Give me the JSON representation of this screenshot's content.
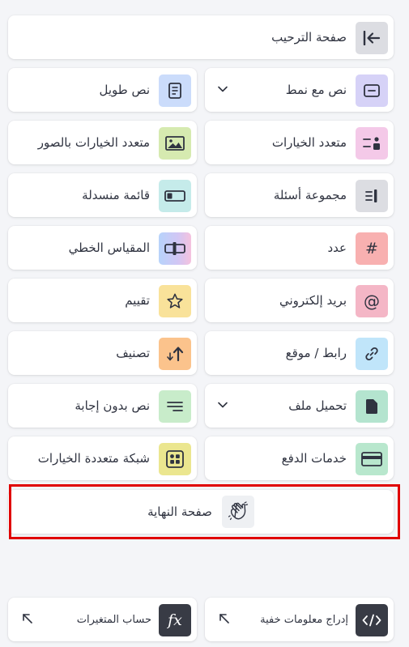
{
  "welcome": {
    "label": "صفحة الترحيب"
  },
  "items": {
    "styled_text": "نص مع نمط",
    "long_text": "نص طويل",
    "multiple_choice": "متعدد الخيارات",
    "picture_choice": "متعدد الخيارات بالصور",
    "question_group": "مجموعة أسئلة",
    "dropdown": "قائمة منسدلة",
    "number": "عدد",
    "opinion_scale": "المقياس الخطي",
    "email": "بريد إلكتروني",
    "rating": "تقييم",
    "website": "رابط / موقع",
    "ranking": "تصنيف",
    "file_upload": "تحميل ملف",
    "statement": "نص بدون إجابة",
    "payment": "خدمات الدفع",
    "matrix": "شبكة متعددة الخيارات"
  },
  "end_screen": {
    "label": "صفحة النهاية"
  },
  "bottom": {
    "hidden_fields": "إدراج معلومات خفية",
    "calculator": "حساب المتغيرات"
  },
  "colors": {
    "welcome_icon_bg": "#dcdde2",
    "styled_text_bg": "#d6d2f7",
    "long_text_bg": "#cbdcfb",
    "multiple_choice_bg": "#f4c9e8",
    "picture_choice_bg": "#d6eab0",
    "question_group_bg": "#dcdde2",
    "dropdown_bg": "#c5ebea",
    "number_bg": "#f8b0b0",
    "opinion_scale_bg": "#c9d8f8",
    "email_bg": "#f4b6c6",
    "rating_bg": "#f9e29a",
    "website_bg": "#c0e5fa",
    "ranking_bg": "#fbc38c",
    "file_upload_bg": "#b4e4cf",
    "statement_bg": "#c8ecca",
    "payment_bg": "#b8e7cd",
    "matrix_bg": "#ebe68f",
    "end_icon_bg": "#eef0f3",
    "highlight": "#e00000",
    "dark_icon_bg": "#383b45"
  },
  "icons": {
    "welcome": "arrow-to-left-icon",
    "styled_text": "text-box-icon",
    "long_text": "document-icon",
    "multiple_choice": "checklist-icon",
    "picture_choice": "image-icon",
    "question_group": "group-icon",
    "dropdown": "dropdown-icon",
    "number": "hash-icon",
    "opinion_scale": "scale-icon",
    "email": "at-icon",
    "rating": "star-icon",
    "website": "link-icon",
    "ranking": "sort-arrows-icon",
    "file_upload": "file-icon",
    "statement": "lines-icon",
    "payment": "credit-card-icon",
    "matrix": "grid-icon",
    "end_screen": "waving-hand-icon",
    "hidden_fields": "code-icon",
    "calculator": "fx-icon"
  }
}
